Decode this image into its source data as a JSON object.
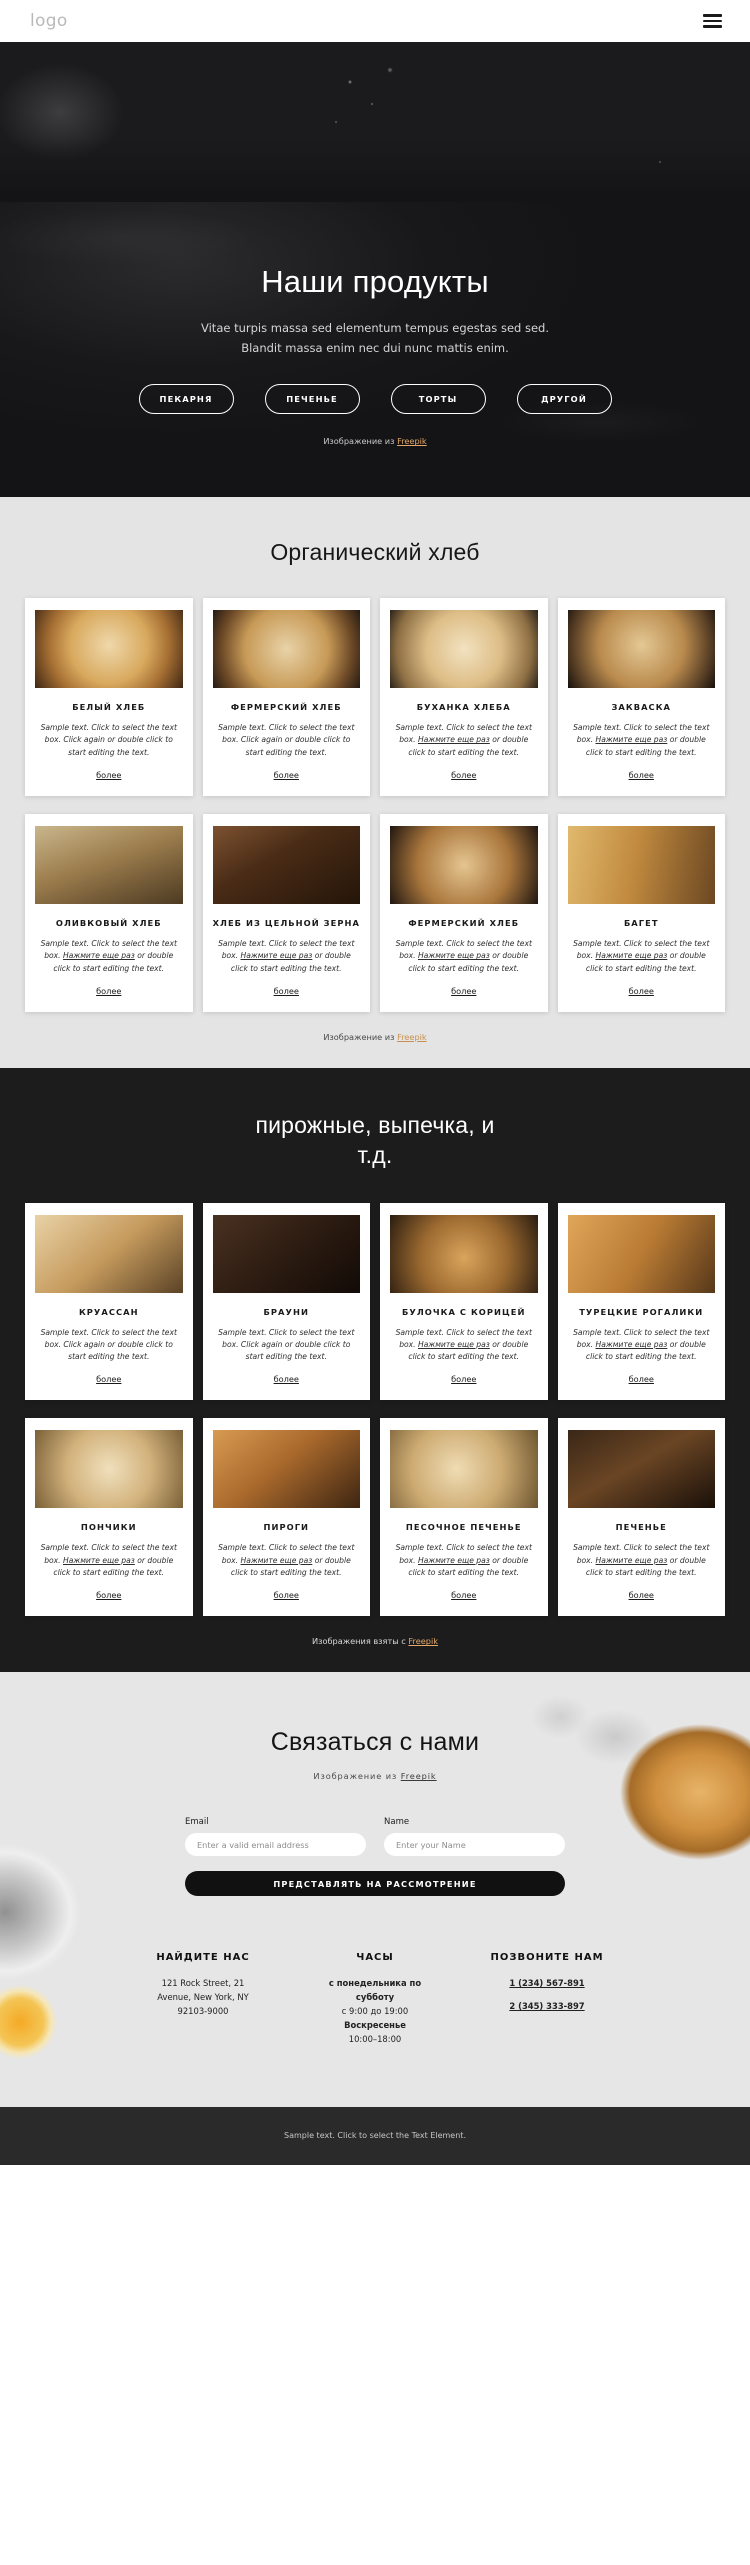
{
  "header": {
    "logo": "logo",
    "menu_icon": "hamburger-icon"
  },
  "hero": {
    "title": "Наши продукты",
    "subtitle_line1": "Vitae turpis massa sed elementum tempus egestas sed sed.",
    "subtitle_line2": "Blandit massa enim nec dui nunc mattis enim.",
    "buttons": [
      {
        "label": "ПЕКАРНЯ"
      },
      {
        "label": "ПЕЧЕНЬЕ"
      },
      {
        "label": "ТОРТЫ"
      },
      {
        "label": "ДРУГОЙ"
      }
    ],
    "credit_prefix": "Изображение из ",
    "credit_link": "Freepik"
  },
  "bread_section": {
    "title": "Органический хлеб",
    "credit_prefix": "Изображение из ",
    "credit_link": "Freepik",
    "more_label": "более",
    "text_plain": "Sample text. Click to select the text box. Click again or double click to start editing the text.",
    "text_ru_a": "Sample text. Click to select the text box. ",
    "text_ru_b": "Нажмите еще раз",
    "text_ru_c": " or double click to start editing the text.",
    "cards": [
      {
        "title": "БЕЛЫЙ ХЛЕБ",
        "variant": "plain"
      },
      {
        "title": "ФЕРМЕРСКИЙ ХЛЕБ",
        "variant": "plain"
      },
      {
        "title": "БУХАНКА ХЛЕБА",
        "variant": "ru"
      },
      {
        "title": "ЗАКВАСКА",
        "variant": "ru"
      },
      {
        "title": "ОЛИВКОВЫЙ ХЛЕБ",
        "variant": "ru"
      },
      {
        "title": "ХЛЕБ ИЗ ЦЕЛЬНОЙ ЗЕРНА",
        "variant": "ru"
      },
      {
        "title": "ФЕРМЕРСКИЙ ХЛЕБ",
        "variant": "ru"
      },
      {
        "title": "БАГЕТ",
        "variant": "ru"
      }
    ]
  },
  "pastry_section": {
    "title_line1": "пирожные, выпечка, и",
    "title_line2": "т.д.",
    "credit_prefix": "Изображения взяты с ",
    "credit_link": "Freepik",
    "more_label": "более",
    "cards": [
      {
        "title": "КРУАССАН",
        "variant": "plain"
      },
      {
        "title": "БРАУНИ",
        "variant": "plain"
      },
      {
        "title": "БУЛОЧКА С КОРИЦЕЙ",
        "variant": "ru"
      },
      {
        "title": "ТУРЕЦКИЕ РОГАЛИКИ",
        "variant": "ru"
      },
      {
        "title": "ПОНЧИКИ",
        "variant": "ru"
      },
      {
        "title": "ПИРОГИ",
        "variant": "ru"
      },
      {
        "title": "ПЕСОЧНОЕ ПЕЧЕНЬЕ",
        "variant": "ru"
      },
      {
        "title": "ПЕЧЕНЬЕ",
        "variant": "ru"
      }
    ]
  },
  "contact": {
    "title": "Связаться с нами",
    "credit_prefix": "Изображение из ",
    "credit_link": "Freepik",
    "email_label": "Email",
    "email_placeholder": "Enter a valid email address",
    "email_value": "",
    "name_label": "Name",
    "name_placeholder": "Enter your Name",
    "name_value": "",
    "submit_label": "ПРЕДСТАВЛЯТЬ НА РАССМОТРЕНИЕ",
    "columns": [
      {
        "head": "НАЙДИТЕ НАС",
        "lines": [
          {
            "text": "121 Rock Street, 21",
            "style": "normal"
          },
          {
            "text": "Avenue, New York, NY",
            "style": "normal"
          },
          {
            "text": "92103-9000",
            "style": "normal"
          }
        ]
      },
      {
        "head": "ЧАСЫ",
        "lines": [
          {
            "text": "с понедельника по субботу",
            "style": "bold"
          },
          {
            "text": "с 9:00 до 19:00",
            "style": "normal"
          },
          {
            "text": "Воскресенье",
            "style": "bold"
          },
          {
            "text": "10:00–18:00",
            "style": "normal"
          }
        ]
      },
      {
        "head": "ПОЗВОНИТЕ НАМ",
        "lines": [
          {
            "text": "1 (234) 567-891",
            "style": "phone"
          },
          {
            "text": "2 (345) 333-897",
            "style": "phone"
          }
        ]
      }
    ]
  },
  "footer": {
    "text": "Sample text. Click to select the Text Element."
  },
  "colors": {
    "accent": "#e4a86a",
    "dark": "#1c1c1c",
    "light": "#e4e4e4",
    "footer": "#2a2a2a"
  }
}
